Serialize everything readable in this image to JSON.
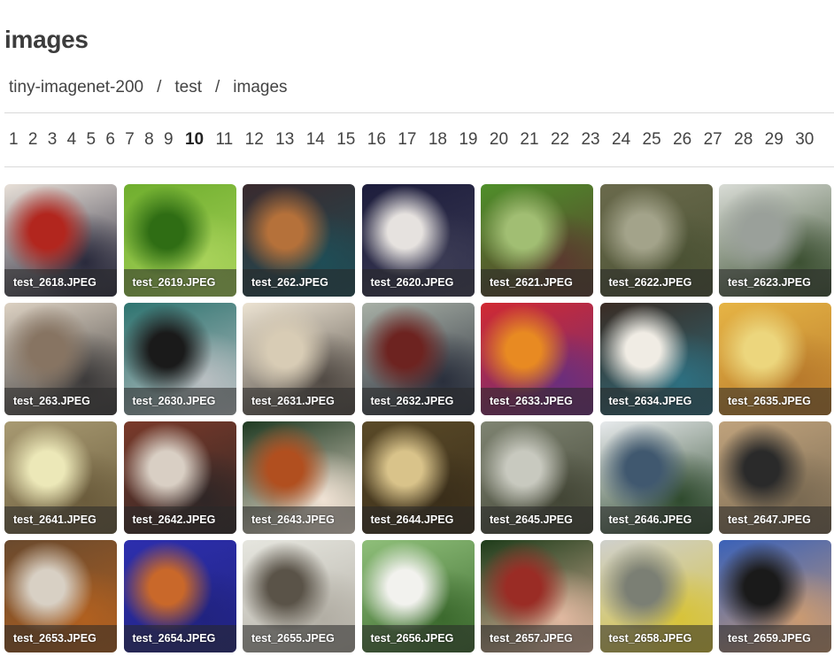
{
  "title": "images",
  "breadcrumb": [
    {
      "label": "tiny-imagenet-200"
    },
    {
      "label": "test"
    },
    {
      "label": "images"
    }
  ],
  "breadcrumb_separator": "/",
  "pagination": {
    "current": "10",
    "pages": [
      "1",
      "2",
      "3",
      "4",
      "5",
      "6",
      "7",
      "8",
      "9",
      "10",
      "11",
      "12",
      "13",
      "14",
      "15",
      "16",
      "17",
      "18",
      "19",
      "20",
      "21",
      "22",
      "23",
      "24",
      "25",
      "26",
      "27",
      "28",
      "29",
      "30"
    ]
  },
  "images": [
    {
      "name": "test_2618.JPEG",
      "colors": [
        "#e8e0d8",
        "#b2261e",
        "#2a2a3c"
      ]
    },
    {
      "name": "test_2619.JPEG",
      "colors": [
        "#6fae2e",
        "#2f6d14",
        "#a8d25a"
      ]
    },
    {
      "name": "test_262.JPEG",
      "colors": [
        "#3a2a2e",
        "#b5713a",
        "#1f4d56"
      ]
    },
    {
      "name": "test_2620.JPEG",
      "colors": [
        "#1d1d3c",
        "#e6e2df",
        "#3b3b54"
      ]
    },
    {
      "name": "test_2621.JPEG",
      "colors": [
        "#4f8f2a",
        "#a1be73",
        "#5a3a2f"
      ]
    },
    {
      "name": "test_2622.JPEG",
      "colors": [
        "#6a6a4c",
        "#a3a38a",
        "#4b5234"
      ]
    },
    {
      "name": "test_2623.JPEG",
      "colors": [
        "#d9dcd6",
        "#9aa09a",
        "#3d5133"
      ]
    },
    {
      "name": "test_263.JPEG",
      "colors": [
        "#ddd2c3",
        "#877462",
        "#3c3a3a"
      ]
    },
    {
      "name": "test_2630.JPEG",
      "colors": [
        "#2e7470",
        "#1a1a1a",
        "#b9bfc2"
      ]
    },
    {
      "name": "test_2631.JPEG",
      "colors": [
        "#ece3d2",
        "#d8ccb5",
        "#514a44"
      ]
    },
    {
      "name": "test_2632.JPEG",
      "colors": [
        "#a8b0a6",
        "#6d2320",
        "#2a2f3c"
      ]
    },
    {
      "name": "test_2633.JPEG",
      "colors": [
        "#d12a32",
        "#e88a22",
        "#6b2e7c"
      ]
    },
    {
      "name": "test_2634.JPEG",
      "colors": [
        "#3a2c24",
        "#f0ece4",
        "#2e6f80"
      ]
    },
    {
      "name": "test_2635.JPEG",
      "colors": [
        "#e6b445",
        "#ecd67d",
        "#b87a2c"
      ]
    },
    {
      "name": "test_2641.JPEG",
      "colors": [
        "#a89a72",
        "#ece8b8",
        "#6b5c3c"
      ]
    },
    {
      "name": "test_2642.JPEG",
      "colors": [
        "#7a3a2a",
        "#d9cfc4",
        "#2f2626"
      ]
    },
    {
      "name": "test_2643.JPEG",
      "colors": [
        "#1f3a22",
        "#b14f1f",
        "#f0e2d4"
      ]
    },
    {
      "name": "test_2644.JPEG",
      "colors": [
        "#5a4a28",
        "#d9c38a",
        "#3a2e1a"
      ]
    },
    {
      "name": "test_2645.JPEG",
      "colors": [
        "#7f8472",
        "#c8c9bf",
        "#434636"
      ]
    },
    {
      "name": "test_2646.JPEG",
      "colors": [
        "#e7eaec",
        "#40586f",
        "#2f4a2e"
      ]
    },
    {
      "name": "test_2647.JPEG",
      "colors": [
        "#bfa27c",
        "#2a2a2a",
        "#7a6a52"
      ]
    },
    {
      "name": "test_2653.JPEG",
      "colors": [
        "#6a4a2e",
        "#d8d0c4",
        "#b06020"
      ]
    },
    {
      "name": "test_2654.JPEG",
      "colors": [
        "#2d2fae",
        "#c9682a",
        "#212380"
      ]
    },
    {
      "name": "test_2655.JPEG",
      "colors": [
        "#e6e6df",
        "#5a5348",
        "#b2aea4"
      ]
    },
    {
      "name": "test_2656.JPEG",
      "colors": [
        "#8fbf7a",
        "#f2f2ee",
        "#3c6a2e"
      ]
    },
    {
      "name": "test_2657.JPEG",
      "colors": [
        "#1e3c1a",
        "#9a2c25",
        "#e0b8a0"
      ]
    },
    {
      "name": "test_2658.JPEG",
      "colors": [
        "#cfd0cc",
        "#7b7f74",
        "#d7c33a"
      ]
    },
    {
      "name": "test_2659.JPEG",
      "colors": [
        "#3b62b8",
        "#1a1a1a",
        "#c99a72"
      ]
    }
  ]
}
